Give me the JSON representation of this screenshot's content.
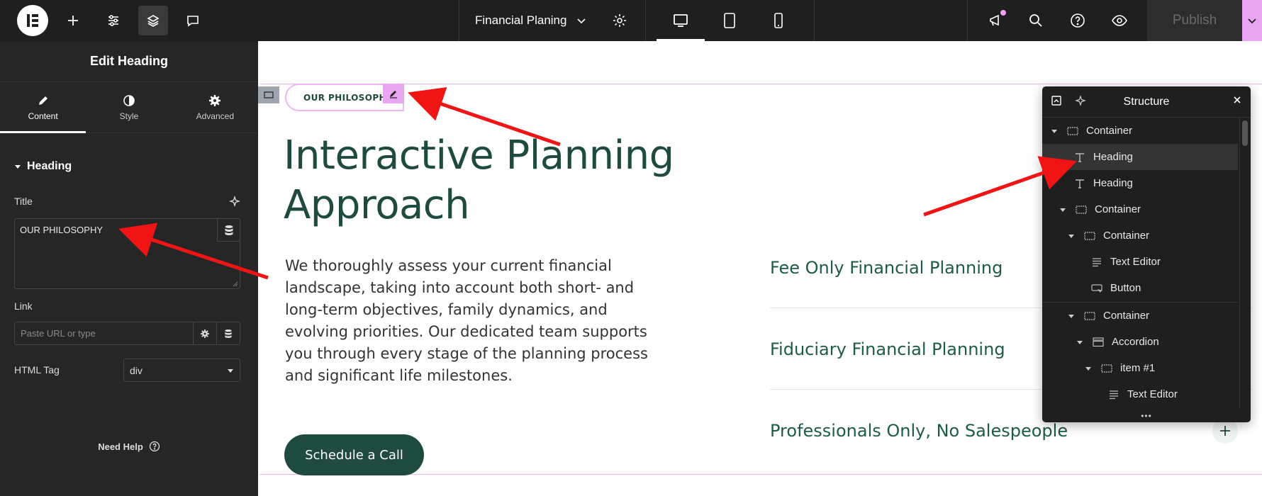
{
  "topbar": {
    "document_title": "Financial Planing",
    "publish_label": "Publish"
  },
  "panel": {
    "title": "Edit Heading",
    "tabs": [
      {
        "label": "Content",
        "icon": "pencil-icon"
      },
      {
        "label": "Style",
        "icon": "half-circle-icon"
      },
      {
        "label": "Advanced",
        "icon": "gear-icon"
      }
    ],
    "section_title": "Heading",
    "title_label": "Title",
    "title_value": "OUR PHILOSOPHY",
    "link_label": "Link",
    "link_placeholder": "Paste URL or type",
    "html_tag_label": "HTML Tag",
    "html_tag_value": "div",
    "need_help": "Need Help"
  },
  "canvas": {
    "eyebrow": "OUR PHILOSOPHY",
    "heading_line1": "Interactive Planning",
    "heading_line2": "Approach",
    "paragraph_lines": [
      "We thoroughly assess your current financial",
      "landscape, taking into account both short- and",
      "long-term objectives, family dynamics, and",
      "evolving priorities. Our dedicated team supports",
      "you through every stage of the planning process",
      "and significant life milestones."
    ],
    "cta_label": "Schedule a Call",
    "accordion_items": [
      "Fee Only Financial Planning",
      "Fiduciary Financial Planning",
      "Professionals Only, No Salespeople"
    ]
  },
  "structure": {
    "title": "Structure",
    "items": [
      {
        "label": "Container",
        "icon": "container-icon"
      },
      {
        "label": "Heading",
        "icon": "heading-icon"
      },
      {
        "label": "Heading",
        "icon": "heading-icon"
      },
      {
        "label": "Container",
        "icon": "container-icon"
      },
      {
        "label": "Container",
        "icon": "container-icon"
      },
      {
        "label": "Text Editor",
        "icon": "text-editor-icon"
      },
      {
        "label": "Button",
        "icon": "button-icon"
      },
      {
        "label": "Container",
        "icon": "container-icon"
      },
      {
        "label": "Accordion",
        "icon": "accordion-icon"
      },
      {
        "label": "item #1",
        "icon": "container-icon"
      },
      {
        "label": "Text Editor",
        "icon": "text-editor-icon"
      }
    ],
    "footer": "•••"
  },
  "colors": {
    "brand_green": "#1e4a40",
    "selection_pink": "#e9a6f0",
    "annotation_red": "#f01414"
  }
}
